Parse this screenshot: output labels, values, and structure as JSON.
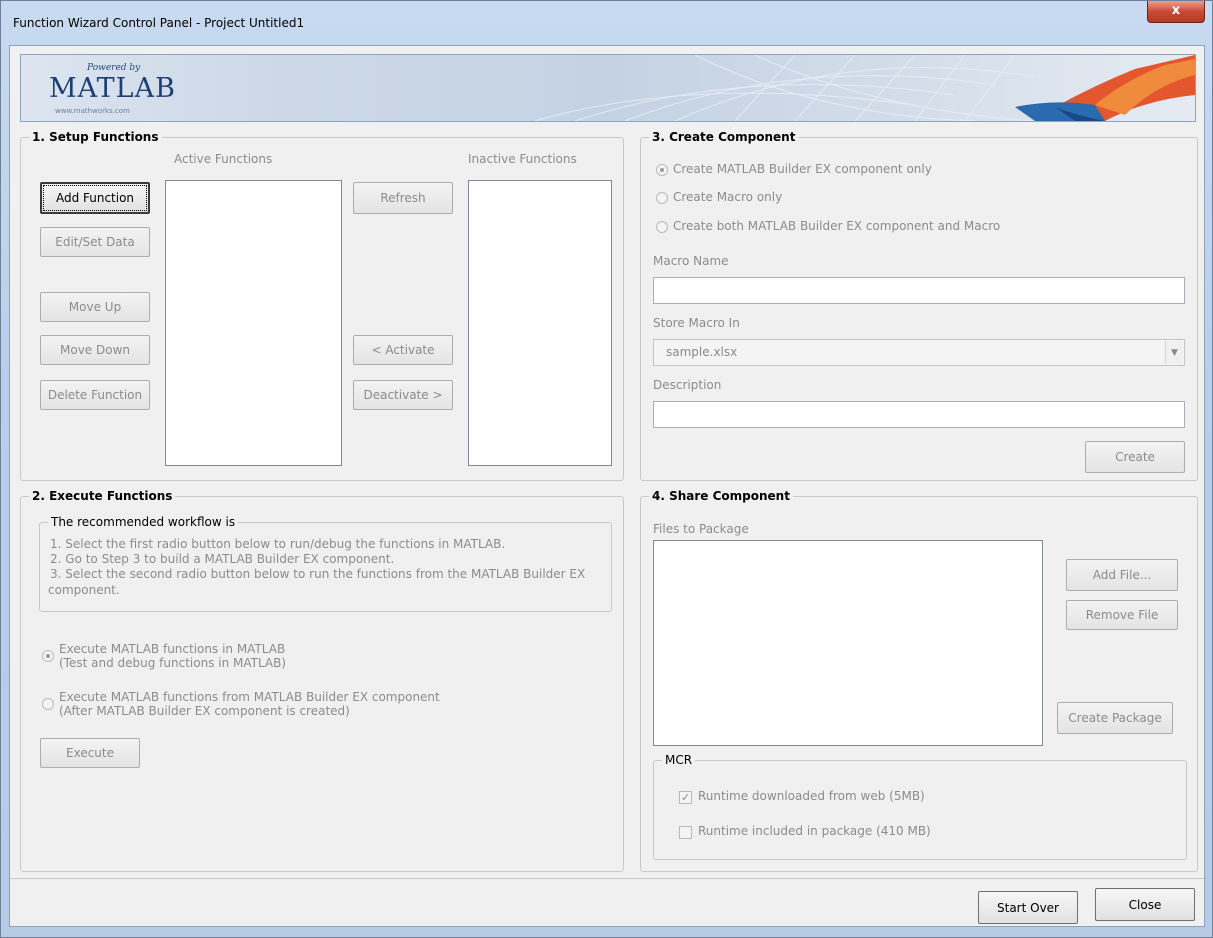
{
  "window": {
    "title": "Function Wizard Control Panel - Project Untitled1",
    "close_glyph": "x"
  },
  "banner": {
    "powered_by": "Powered by",
    "logo": "MATLAB",
    "url": "www.mathworks.com"
  },
  "setup": {
    "title": "1. Setup Functions",
    "active_label": "Active Functions",
    "inactive_label": "Inactive Functions",
    "add_function": "Add Function",
    "edit_set_data": "Edit/Set Data",
    "move_up": "Move Up",
    "move_down": "Move Down",
    "delete_function": "Delete Function",
    "refresh": "Refresh",
    "activate": "< Activate",
    "deactivate": "Deactivate >"
  },
  "execute": {
    "title": "2. Execute Functions",
    "workflow_title": "The recommended workflow is",
    "workflow_1": "1. Select the first radio button below to run/debug the functions in MATLAB.",
    "workflow_2": "2. Go to Step 3 to build a MATLAB Builder EX component.",
    "workflow_3a": "3. Select the second radio button below to run the functions from the MATLAB Builder EX",
    "workflow_3b": "component.",
    "radio1_line1": "Execute MATLAB functions in MATLAB",
    "radio1_line2": "(Test and debug functions in MATLAB)",
    "radio2_line1": "Execute MATLAB functions from MATLAB Builder EX component",
    "radio2_line2": "(After MATLAB Builder EX component is created)",
    "execute_button": "Execute"
  },
  "create": {
    "title": "3. Create Component",
    "option1": "Create MATLAB Builder EX component only",
    "option2": "Create Macro only",
    "option3": "Create both MATLAB Builder EX component and Macro",
    "macro_name_label": "Macro Name",
    "macro_name_value": "",
    "store_in_label": "Store Macro In",
    "store_in_value": "sample.xlsx",
    "description_label": "Description",
    "description_value": "",
    "create_button": "Create"
  },
  "share": {
    "title": "4. Share Component",
    "files_label": "Files to Package",
    "add_file": "Add File...",
    "remove_file": "Remove File",
    "create_package": "Create Package",
    "mcr_title": "MCR",
    "mcr_web": "Runtime downloaded from web (5MB)",
    "mcr_package": "Runtime included in package (410 MB)"
  },
  "footer": {
    "start_over": "Start Over",
    "close": "Close"
  }
}
